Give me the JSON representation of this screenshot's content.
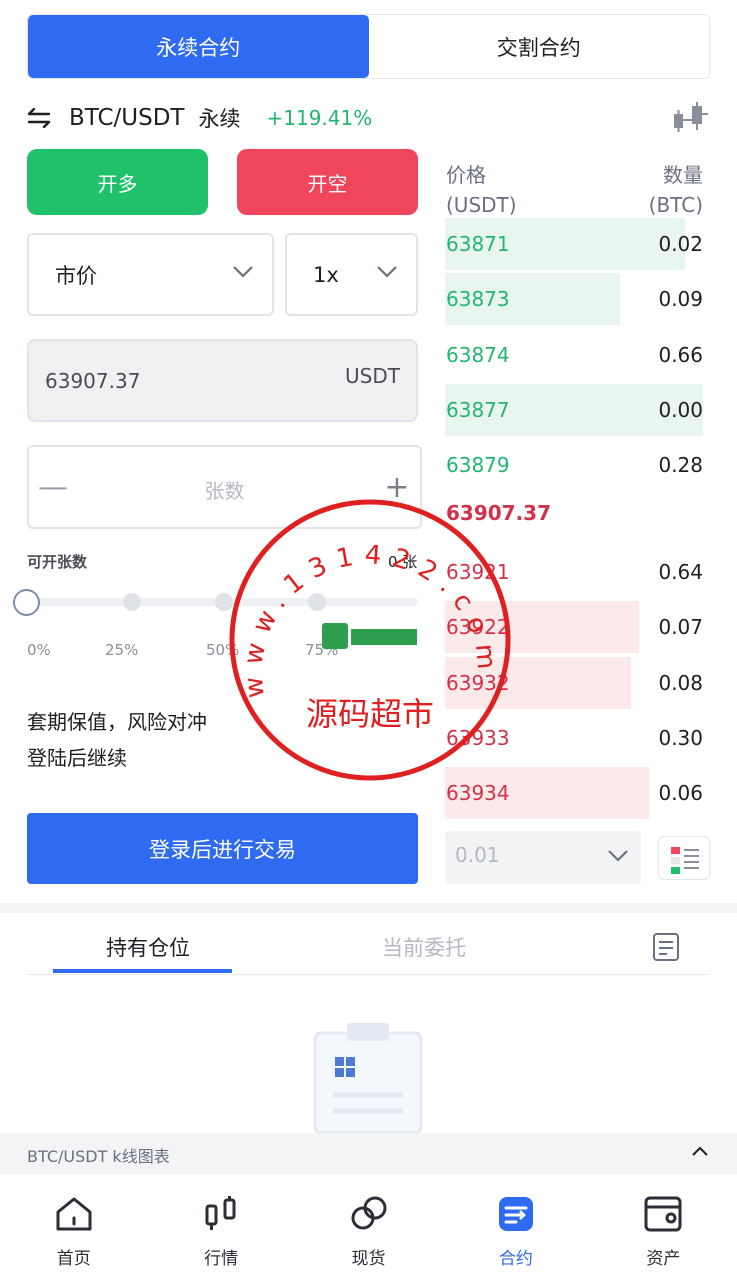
{
  "top_tabs": {
    "perpetual": "永续合约",
    "delivery": "交割合约"
  },
  "pair": {
    "name": "BTC/USDT",
    "type": "永续",
    "change": "+119.41%"
  },
  "actions": {
    "long": "开多",
    "short": "开空",
    "login_trade": "登录后进行交易"
  },
  "order_form": {
    "order_type": "市价",
    "leverage": "1x",
    "price": "63907.37",
    "price_unit": "USDT",
    "qty_placeholder": "张数",
    "qty_minus": "—",
    "qty_plus": "+",
    "avail_label": "可开张数",
    "avail_value": "0 张",
    "slider_value_percent": 0,
    "percents": [
      "0%",
      "25%",
      "50%",
      "75%"
    ],
    "hedge_text": "套期保值，风险对冲",
    "login_continue": "登陆后继续"
  },
  "orderbook": {
    "price_header": "价格",
    "price_unit": "(USDT)",
    "qty_header": "数量",
    "qty_unit": "(BTC)",
    "bids": [
      {
        "price": "63871",
        "qty": "0.02",
        "depth": 0.93
      },
      {
        "price": "63873",
        "qty": "0.09",
        "depth": 0.68
      },
      {
        "price": "63874",
        "qty": "0.66",
        "depth": 0
      },
      {
        "price": "63877",
        "qty": "0.00",
        "depth": 1.0
      },
      {
        "price": "63879",
        "qty": "0.28",
        "depth": 0
      }
    ],
    "mid_price": "63907.37",
    "asks": [
      {
        "price": "63921",
        "qty": "0.64",
        "depth": 0
      },
      {
        "price": "63922",
        "qty": "0.07",
        "depth": 0.75
      },
      {
        "price": "63932",
        "qty": "0.08",
        "depth": 0.72
      },
      {
        "price": "63933",
        "qty": "0.30",
        "depth": 0
      },
      {
        "price": "63934",
        "qty": "0.06",
        "depth": 0.79
      }
    ],
    "precision": "0.01"
  },
  "positions": {
    "holding_tab": "持有仓位",
    "orders_tab": "当前委托"
  },
  "kline_bar": {
    "label": "BTC/USDT k线图表"
  },
  "bottom_nav": [
    {
      "label": "首页",
      "icon": "home-icon"
    },
    {
      "label": "行情",
      "icon": "market-icon"
    },
    {
      "label": "现货",
      "icon": "spot-icon"
    },
    {
      "label": "合约",
      "icon": "contract-icon"
    },
    {
      "label": "资产",
      "icon": "assets-icon"
    }
  ],
  "watermark": {
    "url_text": "www.131422.com",
    "name": "源码超市"
  },
  "colors": {
    "primary": "#2f6bf0",
    "up": "#1fc16b",
    "down": "#f0455a",
    "bid_text": "#22b573",
    "ask_text": "#d0324a"
  }
}
